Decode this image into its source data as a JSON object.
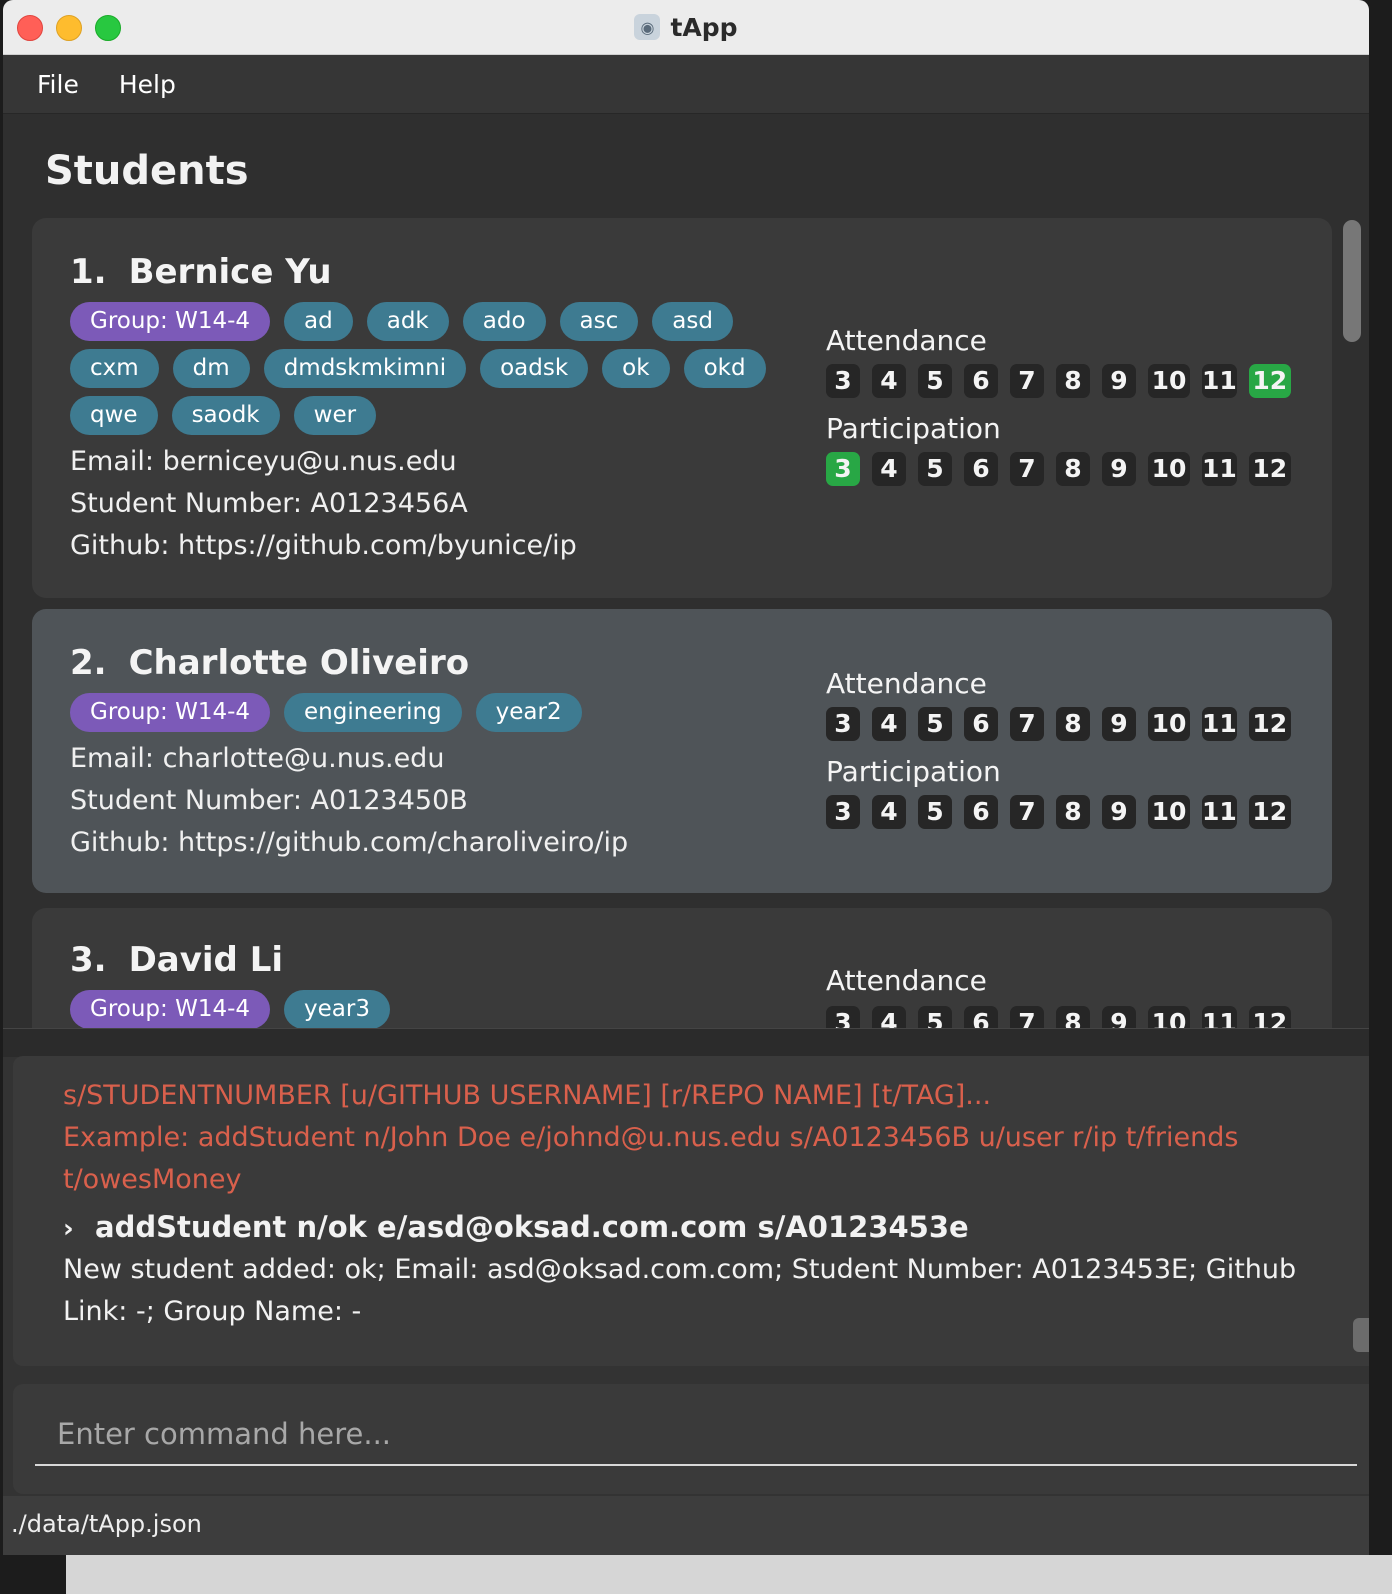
{
  "window": {
    "title": "tApp"
  },
  "menu": {
    "file": "File",
    "help": "Help"
  },
  "list": {
    "title": "Students",
    "attendance_label": "Attendance",
    "participation_label": "Participation",
    "weeks": [
      "3",
      "4",
      "5",
      "6",
      "7",
      "8",
      "9",
      "10",
      "11",
      "12"
    ],
    "students": [
      {
        "index": "1.",
        "name": "Bernice Yu",
        "group": "Group: W14-4",
        "tags": [
          "ad",
          "adk",
          "ado",
          "asc",
          "asd",
          "cxm",
          "dm",
          "dmdskmkimni",
          "oadsk",
          "ok",
          "okd",
          "qwe",
          "saodk",
          "wer"
        ],
        "email": "Email: berniceyu@u.nus.edu",
        "student_number": "Student Number: A0123456A",
        "github": "Github: https://github.com/byunice/ip",
        "attendance_done": [
          "12"
        ],
        "participation_done": [
          "3"
        ]
      },
      {
        "index": "2.",
        "name": "Charlotte Oliveiro",
        "group": "Group: W14-4",
        "tags": [
          "engineering",
          "year2"
        ],
        "email": "Email: charlotte@u.nus.edu",
        "student_number": "Student Number: A0123450B",
        "github": "Github: https://github.com/charoliveiro/ip",
        "attendance_done": [],
        "participation_done": []
      },
      {
        "index": "3.",
        "name": "David Li",
        "group": "Group: W14-4",
        "tags": [
          "year3"
        ],
        "attendance_done": []
      }
    ]
  },
  "result": {
    "error_line_1": "s/STUDENTNUMBER [u/GITHUB USERNAME] [r/REPO NAME] [t/TAG]...",
    "error_line_2": "Example: addStudent n/John Doe e/johnd@u.nus.edu s/A0123456B u/user r/ip t/friends",
    "error_line_3": "t/owesMoney",
    "prompt_glyph": "›",
    "command_echo": "addStudent n/ok e/asd@oksad.com.com s/A0123453e",
    "output_line_1": "New student added: ok; Email: asd@oksad.com.com; Student Number: A0123453E; Github",
    "output_line_2": "Link: -; Group Name: -"
  },
  "command": {
    "placeholder": "Enter command here..."
  },
  "status": {
    "file_path": "./data/tApp.json"
  },
  "icons": {
    "app": "robot-icon"
  },
  "colors": {
    "group_tag": "#7c5ab8",
    "tag": "#3e7b91",
    "done": "#28a745",
    "error": "#d9604c"
  }
}
